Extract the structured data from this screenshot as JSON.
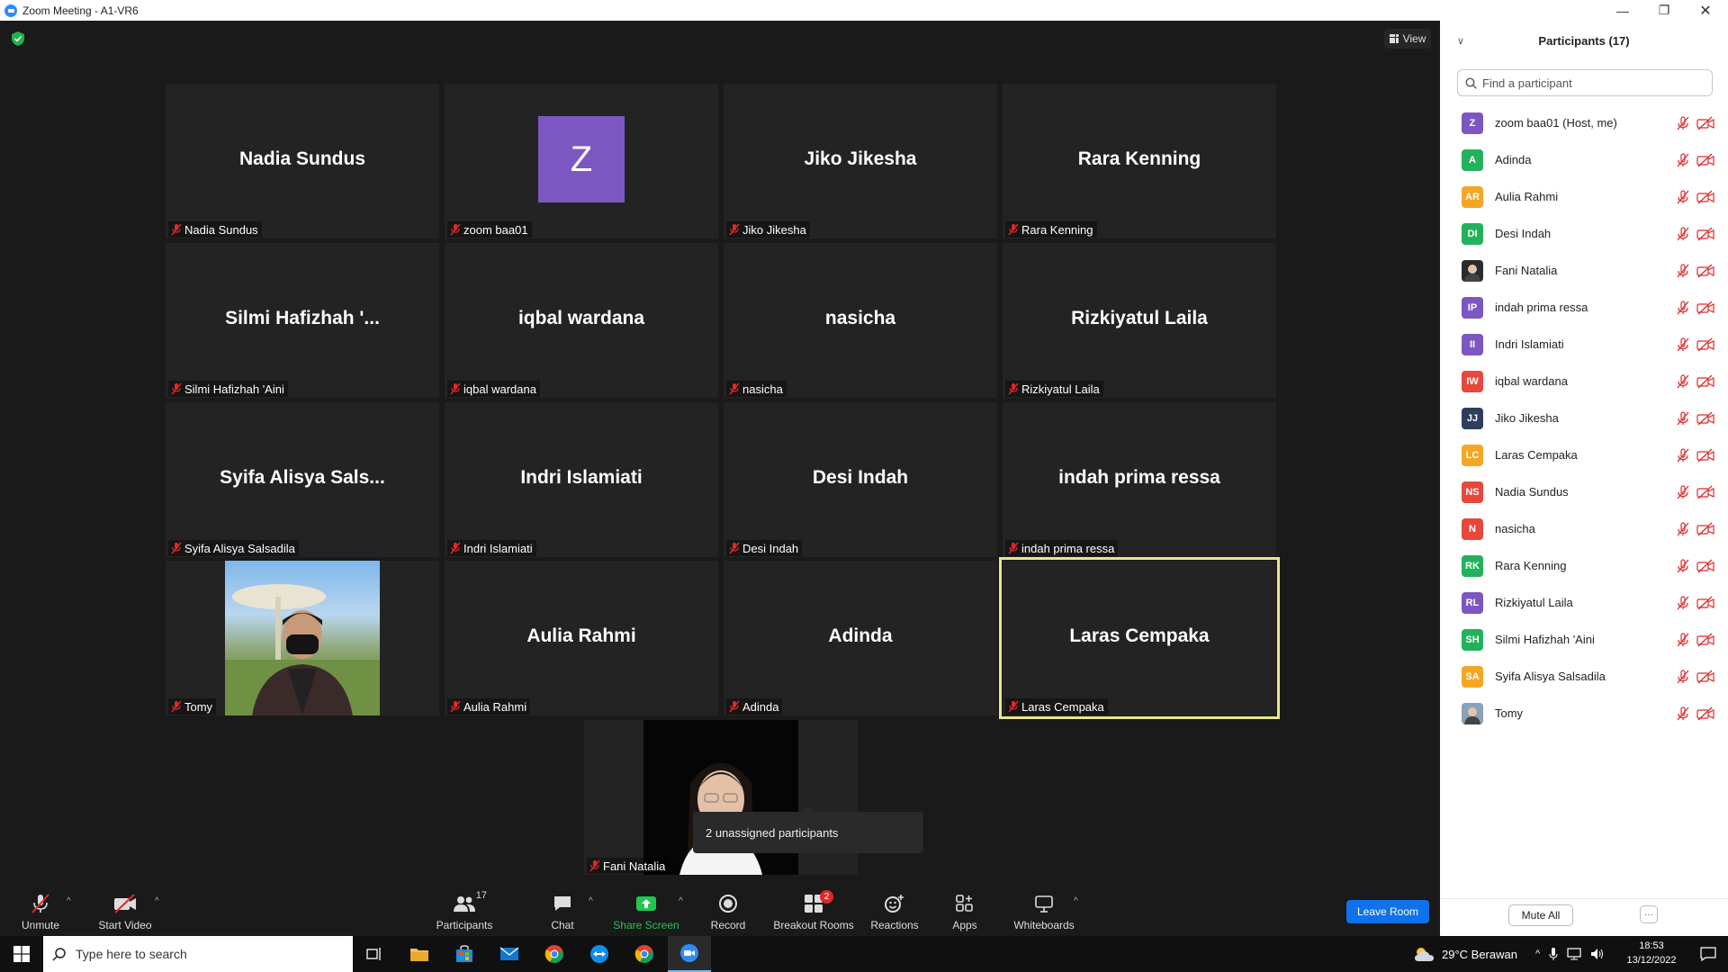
{
  "window": {
    "title": "Zoom Meeting - A1-VR6"
  },
  "view_button": {
    "label": "View"
  },
  "tiles": [
    {
      "big": "Nadia Sundus",
      "label": "Nadia Sundus"
    },
    {
      "big": "Z",
      "label": "zoom baa01"
    },
    {
      "big": "Jiko Jikesha",
      "label": "Jiko Jikesha"
    },
    {
      "big": "Rara Kenning",
      "label": "Rara Kenning"
    },
    {
      "big": "Silmi  Hafizhah  '...",
      "label": "Silmi Hafizhah 'Aini"
    },
    {
      "big": "iqbal wardana",
      "label": "iqbal wardana"
    },
    {
      "big": "nasicha",
      "label": "nasicha"
    },
    {
      "big": "Rizkiyatul Laila",
      "label": "Rizkiyatul Laila"
    },
    {
      "big": "Syifa  Alisya  Sals...",
      "label": "Syifa Alisya Salsadila"
    },
    {
      "big": "Indri Islamiati",
      "label": "Indri Islamiati"
    },
    {
      "big": "Desi Indah",
      "label": "Desi Indah"
    },
    {
      "big": "indah prima ressa",
      "label": "indah prima ressa"
    },
    {
      "big": "",
      "label": "Tomy"
    },
    {
      "big": "Aulia Rahmi",
      "label": "Aulia Rahmi"
    },
    {
      "big": "Adinda",
      "label": "Adinda"
    },
    {
      "big": "Laras Cempaka",
      "label": "Laras Cempaka"
    },
    {
      "big": "",
      "label": "Fani Natalia"
    }
  ],
  "tooltip": {
    "text": "2 unassigned participants"
  },
  "toolbar": {
    "unmute": "Unmute",
    "start_video": "Start Video",
    "participants": "Participants",
    "participants_count": "17",
    "chat": "Chat",
    "share_screen": "Share Screen",
    "record": "Record",
    "breakout_rooms": "Breakout Rooms",
    "breakout_badge": "2",
    "reactions": "Reactions",
    "apps": "Apps",
    "whiteboards": "Whiteboards",
    "leave_room": "Leave Room"
  },
  "panel": {
    "title": "Participants (17)",
    "search_placeholder": "Find a participant",
    "mute_all": "Mute All",
    "participants": [
      {
        "initials": "Z",
        "name": "zoom baa01 (Host, me)",
        "color": "#7d57c1"
      },
      {
        "initials": "A",
        "name": "Adinda",
        "color": "#23b15c"
      },
      {
        "initials": "AR",
        "name": "Aulia Rahmi",
        "color": "#f5a623"
      },
      {
        "initials": "DI",
        "name": "Desi Indah",
        "color": "#23b15c"
      },
      {
        "initials": "",
        "name": "Fani Natalia",
        "color": "#2b2b2b"
      },
      {
        "initials": "IP",
        "name": "indah prima ressa",
        "color": "#7d57c1"
      },
      {
        "initials": "II",
        "name": "Indri Islamiati",
        "color": "#7d57c1"
      },
      {
        "initials": "IW",
        "name": "iqbal wardana",
        "color": "#e8473b"
      },
      {
        "initials": "JJ",
        "name": "Jiko Jikesha",
        "color": "#2f3e5c"
      },
      {
        "initials": "LC",
        "name": "Laras Cempaka",
        "color": "#f5a623"
      },
      {
        "initials": "NS",
        "name": "Nadia Sundus",
        "color": "#e8473b"
      },
      {
        "initials": "N",
        "name": "nasicha",
        "color": "#e8473b"
      },
      {
        "initials": "RK",
        "name": "Rara Kenning",
        "color": "#23b15c"
      },
      {
        "initials": "RL",
        "name": "Rizkiyatul Laila",
        "color": "#7d57c1"
      },
      {
        "initials": "SH",
        "name": "Silmi Hafizhah 'Aini",
        "color": "#23b15c"
      },
      {
        "initials": "SA",
        "name": "Syifa Alisya Salsadila",
        "color": "#f5a623"
      },
      {
        "initials": "",
        "name": "Tomy",
        "color": "#8aa3b8"
      }
    ]
  },
  "taskbar": {
    "search_placeholder": "Type here to search",
    "weather": "29°C  Berawan",
    "time": "18:53",
    "date": "13/12/2022"
  }
}
